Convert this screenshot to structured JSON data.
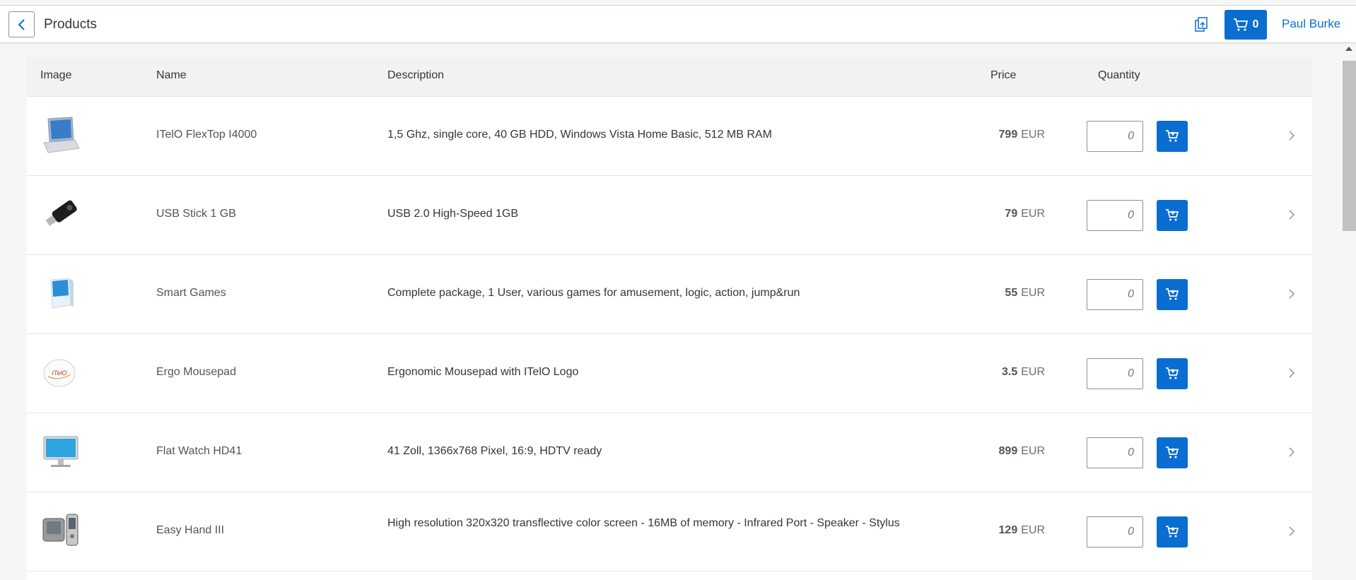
{
  "header": {
    "title": "Products",
    "cart_count": "0",
    "user_name": "Paul Burke"
  },
  "table": {
    "columns": [
      "Image",
      "Name",
      "Description",
      "Price",
      "Quantity"
    ],
    "rows": [
      {
        "name": "ITelO FlexTop I4000",
        "description": "1,5 Ghz, single core, 40 GB HDD, Windows Vista Home Basic, 512 MB RAM",
        "price": "799",
        "currency": "EUR",
        "quantity_placeholder": "0",
        "image": "laptop"
      },
      {
        "name": "USB Stick 1 GB",
        "description": "USB 2.0 High-Speed 1GB",
        "price": "79",
        "currency": "EUR",
        "quantity_placeholder": "0",
        "image": "usb-stick"
      },
      {
        "name": "Smart Games",
        "description": "Complete package, 1 User, various games for amusement, logic, action, jump&run",
        "price": "55",
        "currency": "EUR",
        "quantity_placeholder": "0",
        "image": "software-box"
      },
      {
        "name": "Ergo Mousepad",
        "description": "Ergonomic Mousepad with ITelO Logo",
        "price": "3.5",
        "currency": "EUR",
        "quantity_placeholder": "0",
        "image": "mousepad",
        "logo_text": "ITelO"
      },
      {
        "name": "Flat Watch HD41",
        "description": "41 Zoll, 1366x768 Pixel, 16:9, HDTV ready",
        "price": "899",
        "currency": "EUR",
        "quantity_placeholder": "0",
        "image": "monitor"
      },
      {
        "name": "Easy Hand III",
        "description": "High resolution 320x320 transflective color screen - 16MB of memory - Infrared Port - Speaker - Stylus",
        "price": "129",
        "currency": "EUR",
        "quantity_placeholder": "0",
        "image": "handheld"
      }
    ]
  },
  "colors": {
    "accent": "#0a6ed1",
    "background": "#f5f6f7",
    "header_row": "#f2f2f2"
  }
}
